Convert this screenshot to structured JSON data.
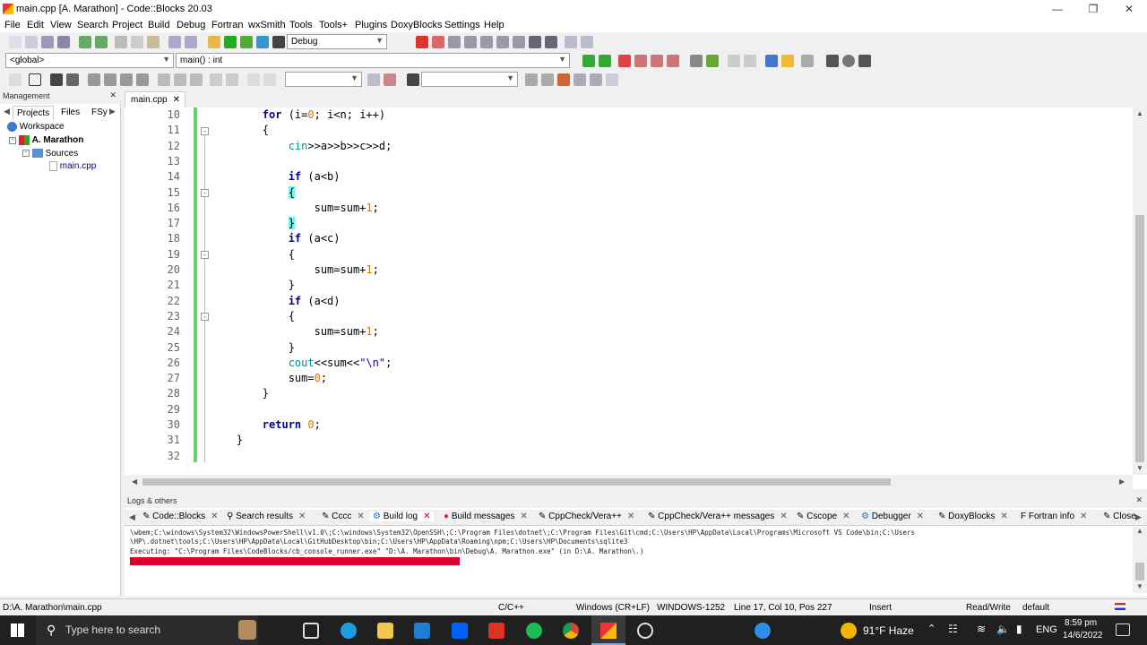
{
  "window": {
    "title": "main.cpp [A. Marathon] - Code::Blocks 20.03"
  },
  "menu": [
    "File",
    "Edit",
    "View",
    "Search",
    "Project",
    "Build",
    "Debug",
    "Fortran",
    "wxSmith",
    "Tools",
    "Tools+",
    "Plugins",
    "DoxyBlocks",
    "Settings",
    "Help"
  ],
  "toolbar": {
    "build_target": "Debug",
    "scope": "<global>",
    "function": "main() : int",
    "search_text": "",
    "search_text2": ""
  },
  "management": {
    "title": "Management",
    "tabs": [
      "Projects",
      "Files",
      "FSy"
    ],
    "tree": {
      "workspace": "Workspace",
      "project": "A. Marathon",
      "folder": "Sources",
      "file": "main.cpp"
    }
  },
  "editor": {
    "tab": "main.cpp",
    "lines": [
      {
        "n": "10",
        "code": "        for (i=0; i<n; i++)"
      },
      {
        "n": "11",
        "code": "        {"
      },
      {
        "n": "12",
        "code": "            cin>>a>>b>>c>>d;"
      },
      {
        "n": "13",
        "code": ""
      },
      {
        "n": "14",
        "code": "            if (a<b)"
      },
      {
        "n": "15",
        "code": "            {"
      },
      {
        "n": "16",
        "code": "                sum=sum+1;"
      },
      {
        "n": "17",
        "code": "            }"
      },
      {
        "n": "18",
        "code": "            if (a<c)"
      },
      {
        "n": "19",
        "code": "            {"
      },
      {
        "n": "20",
        "code": "                sum=sum+1;"
      },
      {
        "n": "21",
        "code": "            }"
      },
      {
        "n": "22",
        "code": "            if (a<d)"
      },
      {
        "n": "23",
        "code": "            {"
      },
      {
        "n": "24",
        "code": "                sum=sum+1;"
      },
      {
        "n": "25",
        "code": "            }"
      },
      {
        "n": "26",
        "code": "            cout<<sum<<\"\\n\";"
      },
      {
        "n": "27",
        "code": "            sum=0;"
      },
      {
        "n": "28",
        "code": "        }"
      },
      {
        "n": "29",
        "code": ""
      },
      {
        "n": "30",
        "code": "        return 0;"
      },
      {
        "n": "31",
        "code": "    }"
      },
      {
        "n": "32",
        "code": ""
      }
    ]
  },
  "logs": {
    "title": "Logs & others",
    "tabs": [
      "Code::Blocks",
      "Search results",
      "Cccc",
      "Build log",
      "Build messages",
      "CppCheck/Vera++",
      "CppCheck/Vera++ messages",
      "Cscope",
      "Debugger",
      "DoxyBlocks",
      "Fortran info",
      "Closed files list"
    ],
    "line1": "\\wbem;C:\\windows\\System32\\WindowsPowerShell\\v1.0\\;C:\\windows\\System32\\OpenSSH\\;C:\\Program Files\\dotnet\\;C:\\Program Files\\Git\\cmd;C:\\Users\\HP\\AppData\\Local\\Programs\\Microsoft VS Code\\bin;C:\\Users",
    "line2": "\\HP\\.dotnet\\tools;C:\\Users\\HP\\AppData\\Local\\GitHubDesktop\\bin;C:\\Users\\HP\\AppData\\Roaming\\npm;C:\\Users\\HP\\Documents\\sqlite3",
    "line3": "Executing: \"C:\\Program Files\\CodeBlocks/cb_console_runner.exe\" \"D:\\A. Marathon\\bin\\Debug\\A. Marathon.exe\"  (in D:\\A. Marathon\\.)"
  },
  "status": {
    "path": "D:\\A. Marathon\\main.cpp",
    "lang": "C/C++",
    "eol": "Windows (CR+LF)",
    "encoding": "WINDOWS-1252",
    "position": "Line 17, Col 10, Pos 227",
    "mode": "Insert",
    "access": "Read/Write",
    "profile": "default"
  },
  "taskbar": {
    "search_placeholder": "Type here to search",
    "weather": "91°F Haze",
    "lang": "ENG",
    "time": "8:59 pm",
    "date": "14/6/2022"
  }
}
